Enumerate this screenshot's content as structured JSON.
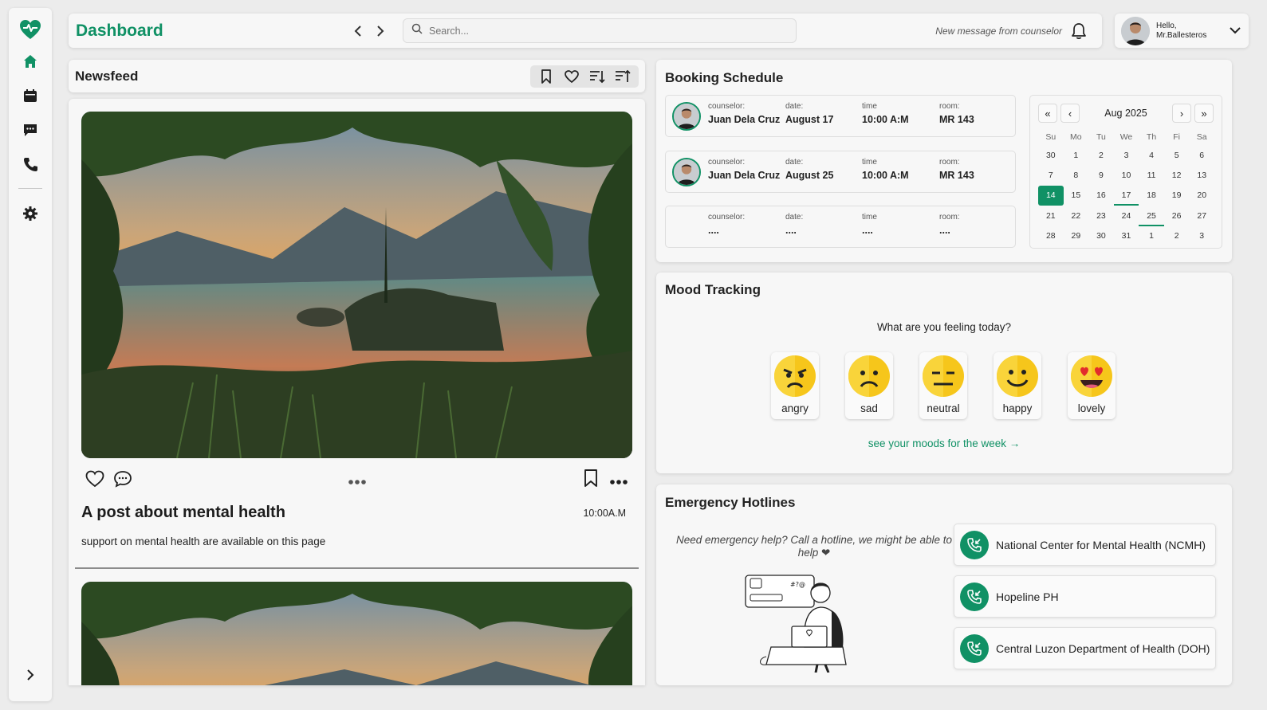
{
  "colors": {
    "accent": "#109165",
    "background": "#ececec",
    "card": "#f7f7f7"
  },
  "topbar": {
    "title": "Dashboard",
    "search_placeholder": "Search...",
    "notification_text": "New message from counselor"
  },
  "user": {
    "greeting": "Hello,",
    "name": "Mr.Ballesteros"
  },
  "sidebar": {
    "items": [
      {
        "icon": "home-icon"
      },
      {
        "icon": "calendar-icon"
      },
      {
        "icon": "chat-icon"
      },
      {
        "icon": "phone-icon"
      },
      {
        "icon": "gear-icon"
      }
    ]
  },
  "newsfeed": {
    "title": "Newsfeed",
    "tools": [
      "bookmark-icon",
      "heart-icon",
      "sort-desc-icon",
      "sort-asc-icon"
    ],
    "posts": [
      {
        "title": "A post about mental health",
        "time": "10:00A.M",
        "body": "support on mental health are available on this page"
      }
    ]
  },
  "booking": {
    "title": "Booking Schedule",
    "labels": {
      "counselor": "counselor:",
      "date": "date:",
      "time": "time",
      "room": "room:"
    },
    "rows": [
      {
        "counselor": "Juan Dela Cruz",
        "date": "August 17",
        "time": "10:00 A:M",
        "room": "MR 143"
      },
      {
        "counselor": "Juan Dela Cruz",
        "date": "August 25",
        "time": "10:00 A:M",
        "room": "MR 143"
      },
      {
        "counselor": "....",
        "date": "....",
        "time": "....",
        "room": "...."
      }
    ],
    "calendar": {
      "month": "Aug 2025",
      "weekdays": [
        "Su",
        "Mo",
        "Tu",
        "We",
        "Th",
        "Fi",
        "Sa"
      ],
      "days": [
        "30",
        "1",
        "2",
        "3",
        "4",
        "5",
        "6",
        "7",
        "8",
        "9",
        "10",
        "11",
        "12",
        "13",
        "14",
        "15",
        "16",
        "17",
        "18",
        "19",
        "20",
        "21",
        "22",
        "23",
        "24",
        "25",
        "26",
        "27",
        "28",
        "29",
        "30",
        "31",
        "1",
        "2",
        "3"
      ],
      "selected": "14",
      "marked": [
        "17",
        "25"
      ]
    }
  },
  "mood": {
    "title": "Mood Tracking",
    "question": "What are you feeling today?",
    "options": [
      "angry",
      "sad",
      "neutral",
      "happy",
      "lovely"
    ],
    "link": "see your moods for the week →"
  },
  "hotlines": {
    "title": "Emergency Hotlines",
    "note": "Need emergency help? Call a hotline, we might be able to help ❤",
    "items": [
      "National Center for Mental Health (NCMH)",
      "Hopeline PH",
      "Central Luzon Department of Health (DOH)"
    ]
  }
}
